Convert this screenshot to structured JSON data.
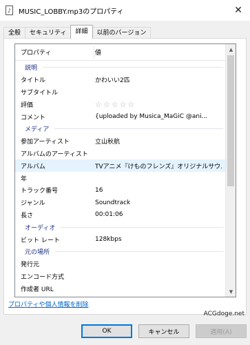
{
  "window": {
    "title": "MUSIC_LOBBY.mp3のプロパティ",
    "close_glyph": "✕"
  },
  "tabs": [
    {
      "label": "全般",
      "active": false
    },
    {
      "label": "セキュリティ",
      "active": false
    },
    {
      "label": "詳細",
      "active": true
    },
    {
      "label": "以前のバージョン",
      "active": false
    }
  ],
  "list": {
    "header": {
      "property": "プロパティ",
      "value": "値"
    },
    "groups": {
      "description": "説明",
      "media": "メディア",
      "audio": "オーディオ",
      "origin": "元の場所"
    },
    "rows": {
      "title": {
        "k": "タイトル",
        "v": "かわいい2匹"
      },
      "subtitle": {
        "k": "サブタイトル",
        "v": ""
      },
      "rating": {
        "k": "評価",
        "v": "☆☆☆☆☆",
        "stars": 0
      },
      "comment": {
        "k": "コメント",
        "v": "{uploaded by Musica_MaGiC @ani..."
      },
      "artist": {
        "k": "参加アーティスト",
        "v": "立山秋航"
      },
      "album_artist": {
        "k": "アルバムのアーティスト",
        "v": ""
      },
      "album": {
        "k": "アルバム",
        "v": "TVアニメ『けものフレンズ』オリジナルサウ..."
      },
      "year": {
        "k": "年",
        "v": ""
      },
      "track": {
        "k": "トラック番号",
        "v": "16"
      },
      "genre": {
        "k": "ジャンル",
        "v": "Soundtrack"
      },
      "length": {
        "k": "長さ",
        "v": "00:01:06"
      },
      "bitrate": {
        "k": "ビット レート",
        "v": "128kbps"
      },
      "publisher": {
        "k": "発行元",
        "v": ""
      },
      "encoded_by": {
        "k": "エンコード方式",
        "v": ""
      },
      "author_url": {
        "k": "作成者 URL",
        "v": ""
      }
    }
  },
  "remove_link": "プロパティや個人情報を削除",
  "watermark": "ACGdoge.net",
  "buttons": {
    "ok": "OK",
    "cancel": "キャンセル",
    "apply": "適用(A)"
  }
}
